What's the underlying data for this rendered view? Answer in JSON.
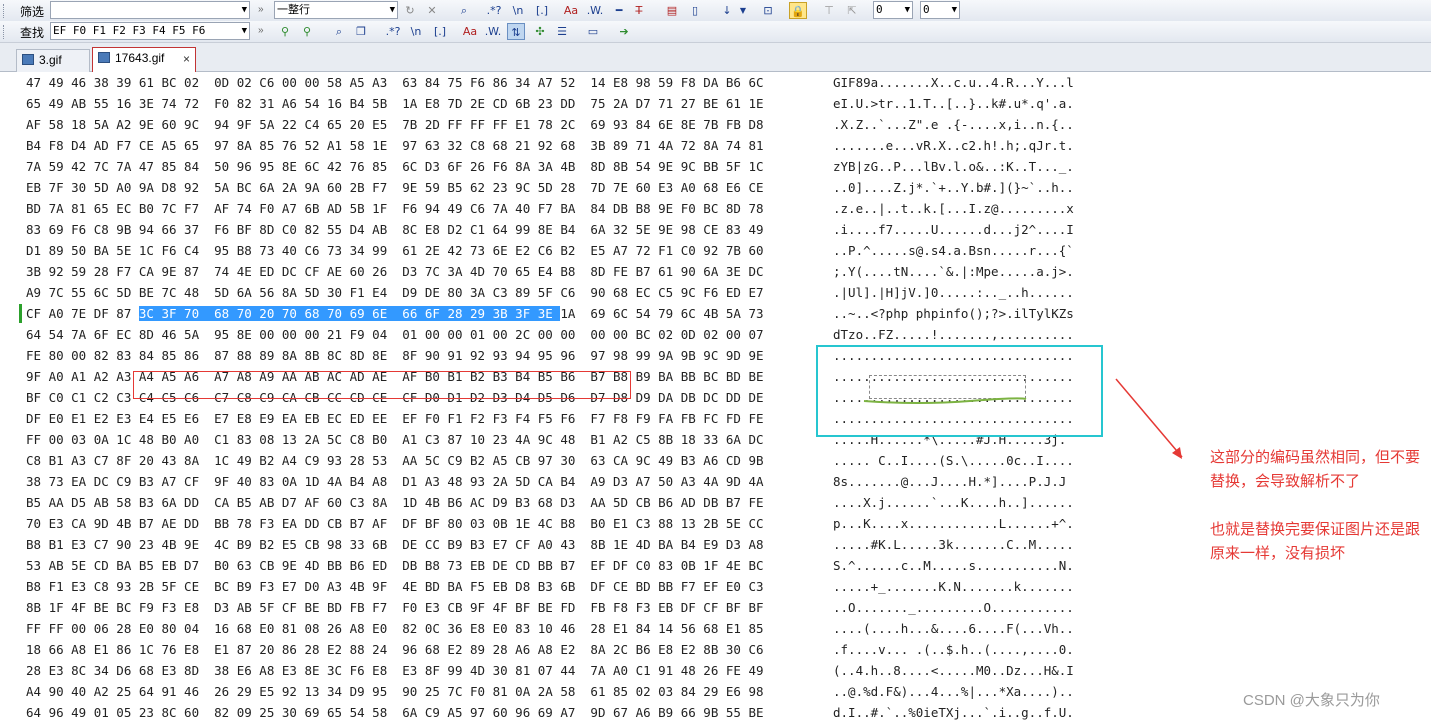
{
  "toolbar1": {
    "filter_label": "筛选",
    "filter_value": "",
    "mode_value": "一整行",
    "num1": "0",
    "num2": "0"
  },
  "toolbar2": {
    "find_label": "查找",
    "find_value": "EF F0 F1 F2 F3 F4 F5 F6"
  },
  "tabs": [
    {
      "label": "3.gif",
      "active": false
    },
    {
      "label": "17643.gif",
      "active": true
    }
  ],
  "selected_row_index": 12,
  "rows": [
    {
      "hex": "47 49 46 38 39 61 BC 02  0D 02 C6 00 00 58 A5 A3  63 84 75 F6 86 34 A7 52  14 E8 98 59 F8 DA B6 6C",
      "ascii": "GIF89a.......X..c.u..4.R...Y...l"
    },
    {
      "hex": "65 49 AB 55 16 3E 74 72  F0 82 31 A6 54 16 B4 5B  1A E8 7D 2E CD 6B 23 DD  75 2A D7 71 27 BE 61 1E",
      "ascii": "eI.U.>tr..1.T..[..}..k#.u*.q'.a."
    },
    {
      "hex": "AF 58 18 5A A2 9E 60 9C  94 9F 5A 22 C4 65 20 E5  7B 2D FF FF FF E1 78 2C  69 93 84 6E 8E 7B FB D8",
      "ascii": ".X.Z..`...Z\".e .{-....x,i..n.{.."
    },
    {
      "hex": "B4 F8 D4 AD F7 CE A5 65  97 8A 85 76 52 A1 58 1E  97 63 32 C8 68 21 92 68  3B 89 71 4A 72 8A 74 81",
      "ascii": ".......e...vR.X..c2.h!.h;.qJr.t."
    },
    {
      "hex": "7A 59 42 7C 7A 47 85 84  50 96 95 8E 6C 42 76 85  6C D3 6F 26 F6 8A 3A 4B  8D 8B 54 9E 9C BB 5F 1C",
      "ascii": "zYB|zG..P...lBv.l.o&..:K..T..._."
    },
    {
      "hex": "EB 7F 30 5D A0 9A D8 92  5A BC 6A 2A 9A 60 2B F7  9E 59 B5 62 23 9C 5D 28  7D 7E 60 E3 A0 68 E6 CE",
      "ascii": "..0]....Z.j*.`+..Y.b#.](}~`..h.."
    },
    {
      "hex": "BD 7A 81 65 EC B0 7C F7  AF 74 F0 A7 6B AD 5B 1F  F6 94 49 C6 7A 40 F7 BA  84 DB B8 9E F0 BC 8D 78",
      "ascii": ".z.e..|..t..k.[...I.z@.........x"
    },
    {
      "hex": "83 69 F6 C8 9B 94 66 37  F6 BF 8D C0 82 55 D4 AB  8C E8 D2 C1 64 99 8E B4  6A 32 5E 9E 98 CE 83 49",
      "ascii": ".i....f7.....U......d...j2^....I"
    },
    {
      "hex": "D1 89 50 BA 5E 1C F6 C4  95 B8 73 40 C6 73 34 99  61 2E 42 73 6E E2 C6 B2  E5 A7 72 F1 C0 92 7B 60",
      "ascii": "..P.^.....s@.s4.a.Bsn.....r...{`"
    },
    {
      "hex": "3B 92 59 28 F7 CA 9E 87  74 4E ED DC CF AE 60 26  D3 7C 3A 4D 70 65 E4 B8  8D FE B7 61 90 6A 3E DC",
      "ascii": ";.Y(....tN....`&.|:Mpe.....a.j>."
    },
    {
      "hex": "A9 7C 55 6C 5D BE 7C 48  5D 6A 56 8A 5D 30 F1 E4  D9 DE 80 3A C3 89 5F C6  90 68 EC C5 9C F6 ED E7",
      "ascii": ".|Ul].|H]jV.]0.....:.._..h......"
    },
    {
      "hex": "CF A0 7E DF 87 3C 3F 70  68 70 20 70 68 70 69 6E  66 6F 28 29 3B 3F 3E 1A  69 6C 54 79 6C 4B 5A 73",
      "ascii": "..~..<?php phpinfo();?>.ilTylKZs"
    },
    {
      "hex": "64 54 7A 6F EC 8D 46 5A  95 8E 00 00 00 21 F9 04  01 00 00 01 00 2C 00 00  00 00 BC 02 0D 02 00 07",
      "ascii": "dTzo..FZ.....!.......,.........."
    },
    {
      "hex": "FE 80 00 82 83 84 85 86  87 88 89 8A 8B 8C 8D 8E  8F 90 91 92 93 94 95 96  97 98 99 9A 9B 9C 9D 9E",
      "ascii": "................................"
    },
    {
      "hex": "9F A0 A1 A2 A3 A4 A5 A6  A7 A8 A9 AA AB AC AD AE  AF B0 B1 B2 B3 B4 B5 B6  B7 B8 B9 BA BB BC BD BE",
      "ascii": "................................"
    },
    {
      "hex": "BF C0 C1 C2 C3 C4 C5 C6  C7 C8 C9 CA CB CC CD CE  CF D0 D1 D2 D3 D4 D5 D6  D7 D8 D9 DA DB DC DD DE",
      "ascii": "................................"
    },
    {
      "hex": "DF E0 E1 E2 E3 E4 E5 E6  E7 E8 E9 EA EB EC ED EE  EF F0 F1 F2 F3 F4 F5 F6  F7 F8 F9 FA FB FC FD FE",
      "ascii": "................................"
    },
    {
      "hex": "FF 00 03 0A 1C 48 B0 A0  C1 83 08 13 2A 5C C8 B0  A1 C3 87 10 23 4A 9C 48  B1 A2 C5 8B 18 33 6A DC",
      "ascii": ".....H......*\\.....#J.H.....3j."
    },
    {
      "hex": "C8 B1 A3 C7 8F 20 43 8A  1C 49 B2 A4 C9 93 28 53  AA 5C C9 B2 A5 CB 97 30  63 CA 9C 49 B3 A6 CD 9B",
      "ascii": "..... C..I....(S.\\.....0c..I...."
    },
    {
      "hex": "38 73 EA DC C9 B3 A7 CF  9F 40 83 0A 1D 4A B4 A8  D1 A3 48 93 2A 5D CA B4  A9 D3 A7 50 A3 4A 9D 4A",
      "ascii": "8s.......@...J....H.*]....P.J.J"
    },
    {
      "hex": "B5 AA D5 AB 58 B3 6A DD  CA B5 AB D7 AF 60 C3 8A  1D 4B B6 AC D9 B3 68 D3  AA 5D CB B6 AD DB B7 FE",
      "ascii": "....X.j......`...K....h..]......"
    },
    {
      "hex": "70 E3 CA 9D 4B B7 AE DD  BB 78 F3 EA DD CB B7 AF  DF BF 80 03 0B 1E 4C B8  B0 E1 C3 88 13 2B 5E CC",
      "ascii": "p...K....x............L......+^."
    },
    {
      "hex": "B8 B1 E3 C7 90 23 4B 9E  4C B9 B2 E5 CB 98 33 6B  DE CC B9 B3 E7 CF A0 43  8B 1E 4D BA B4 E9 D3 A8",
      "ascii": ".....#K.L.....3k.......C..M....."
    },
    {
      "hex": "53 AB 5E CD BA B5 EB D7  B0 63 CB 9E 4D BB B6 ED  DB B8 73 EB DE CD BB B7  EF DF C0 83 0B 1F 4E BC",
      "ascii": "S.^......c..M.....s...........N."
    },
    {
      "hex": "B8 F1 E3 C8 93 2B 5F CE  BC B9 F3 E7 D0 A3 4B 9F  4E BD BA F5 EB D8 B3 6B  DF CE BD BB F7 EF E0 C3",
      "ascii": ".....+_.......K.N.......k......."
    },
    {
      "hex": "8B 1F 4F BE BC F9 F3 E8  D3 AB 5F CF BE BD FB F7  F0 E3 CB 9F 4F BF BE FD  FB F8 F3 EB DF CF BF BF",
      "ascii": "..O......._.........O..........."
    },
    {
      "hex": "FF FF 00 06 28 E0 80 04  16 68 E0 81 08 26 A8 E0  82 0C 36 E8 E0 83 10 46  28 E1 84 14 56 68 E1 85",
      "ascii": "....(....h...&....6....F(...Vh.."
    },
    {
      "hex": "18 66 A8 E1 86 1C 76 E8  E1 87 20 86 28 E2 88 24  96 68 E2 89 28 A6 A8 E2  8A 2C B6 E8 E2 8B 30 C6",
      "ascii": ".f....v... .(..$.h..(....,....0."
    },
    {
      "hex": "28 E3 8C 34 D6 68 E3 8D  38 E6 A8 E3 8E 3C F6 E8  E3 8F 99 4D 30 81 07 44  7A A0 C1 91 48 26 FE 49",
      "ascii": "(..4.h..8....<.....M0..Dz...H&.I"
    },
    {
      "hex": "A4 90 40 A2 25 64 91 46  26 29 E5 92 13 34 D9 95  90 25 7C F0 81 0A 2A 58  61 85 02 03 84 29 E6 98",
      "ascii": "..@.%d.F&)...4...%|...*Xa....).."
    },
    {
      "hex": "64 96 49 01 05 23 8C 60  82 09 25 30 69 65 54 58  6A C9 A5 97 60 96 69 A7  9D 67 A6 B9 66 9B 55 BE",
      "ascii": "d.I..#.`..%0ieTXj...`.i..g..f.U."
    }
  ],
  "annotation": {
    "line1": "这部分的编码虽然相同，但不要替换，会导致解析不了",
    "line2": "也就是替换完要保证图片还是跟原来一样，没有损坏",
    "color": "#e53935",
    "box_color": "#26c6d0"
  },
  "watermark": "CSDN @大象只为你"
}
